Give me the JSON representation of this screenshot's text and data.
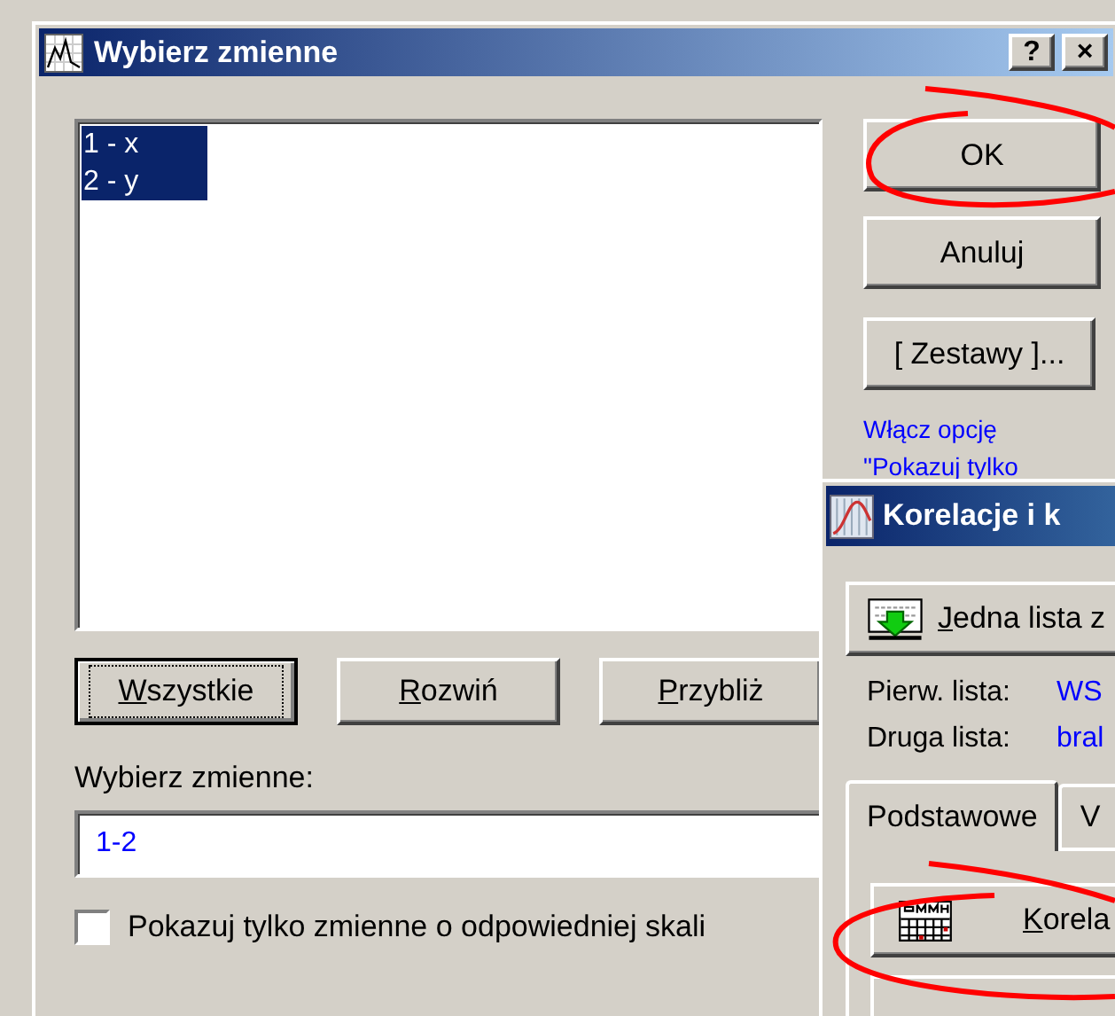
{
  "dialog": {
    "title": "Wybierz zmienne",
    "title_buttons": [
      "?",
      "×"
    ],
    "variables": [
      {
        "label": "1 - x",
        "selected": true
      },
      {
        "label": "2 - y",
        "selected": true
      }
    ],
    "side_buttons": [
      {
        "label": "OK",
        "default": false
      },
      {
        "label": "Anuluj",
        "default": false
      },
      {
        "label": "[ Zestawy ]...",
        "default": false
      }
    ],
    "hint": [
      "Włącz opcję",
      "\"Pokazuj tylko"
    ],
    "list_buttons": [
      {
        "label": "Wszystkie",
        "default": true
      },
      {
        "label": "Rozwiń",
        "default": false
      },
      {
        "label": "Przybliż",
        "default": false
      }
    ],
    "field_label": "Wybierz zmienne:",
    "field_value": "1-2",
    "scale_option": {
      "label": "Pokazuj tylko zmienne o odpowiedniej skali",
      "checked": false
    }
  },
  "correlations_window": {
    "title": "Korelacje i k",
    "list_button": {
      "label": "Jedna lista z"
    },
    "lists": [
      {
        "label": "Pierw. lista:",
        "value": "WS"
      },
      {
        "label": "Druga lista:",
        "value": "bral"
      }
    ],
    "tabs": [
      {
        "label": "Podstawowe",
        "selected": true
      },
      {
        "label": "V",
        "selected": false
      }
    ],
    "action_button": {
      "label": "Korela"
    }
  }
}
